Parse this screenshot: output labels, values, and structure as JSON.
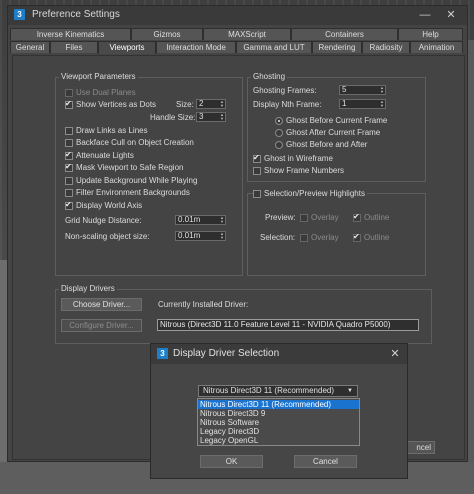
{
  "window": {
    "title": "Preference Settings",
    "minimize": "—",
    "close": "✕"
  },
  "tabs_row1": [
    "Inverse Kinematics",
    "Gizmos",
    "MAXScript",
    "Containers",
    "Help"
  ],
  "tabs_row2": [
    "General",
    "Files",
    "Viewports",
    "Interaction Mode",
    "Gamma and LUT",
    "Rendering",
    "Radiosity",
    "Animation"
  ],
  "active_tab": "Viewports",
  "viewport_params": {
    "label": "Viewport Parameters",
    "use_dual_planes": "Use Dual Planes",
    "show_vertices": "Show Vertices as Dots",
    "size_label": "Size:",
    "size_value": "2",
    "handle_size_label": "Handle Size:",
    "handle_size_value": "3",
    "draw_links": "Draw Links as Lines",
    "backface_cull": "Backface Cull on Object Creation",
    "attenuate_lights": "Attenuate Lights",
    "mask_viewport": "Mask Viewport to Safe Region",
    "update_background": "Update Background While Playing",
    "filter_env": "Filter Environment Backgrounds",
    "display_world_axis": "Display World Axis",
    "grid_nudge_label": "Grid Nudge Distance:",
    "grid_nudge_value": "0.01m",
    "non_scaling_label": "Non-scaling object size:",
    "non_scaling_value": "0.01m"
  },
  "ghosting": {
    "label": "Ghosting",
    "frames_label": "Ghosting Frames:",
    "frames_value": "5",
    "nth_label": "Display Nth Frame:",
    "nth_value": "1",
    "before": "Ghost Before Current Frame",
    "after": "Ghost After Current Frame",
    "before_after": "Ghost Before and After",
    "wireframe": "Ghost in Wireframe",
    "show_numbers": "Show Frame Numbers"
  },
  "selection": {
    "label": "Selection/Preview Highlights",
    "preview_label": "Preview:",
    "selection_label": "Selection:",
    "overlay": "Overlay",
    "outline": "Outline"
  },
  "drivers": {
    "label": "Display Drivers",
    "choose": "Choose Driver...",
    "configure": "Configure Driver...",
    "installed_label": "Currently Installed Driver:",
    "installed_value": "Nitrous (Direct3D 11.0 Feature Level 11 - NVIDIA Quadro P5000)"
  },
  "dialog": {
    "title": "Display Driver Selection",
    "close": "✕",
    "selected": "Nitrous Direct3D 11 (Recommended)",
    "options": [
      "Nitrous Direct3D 11 (Recommended)",
      "Nitrous Direct3D 9",
      "Nitrous Software",
      "Legacy Direct3D",
      "Legacy OpenGL"
    ],
    "ok": "OK",
    "cancel": "Cancel",
    "behind_cancel_fragment": "ncel"
  },
  "colors": {
    "selection_blue": "#1b73d0",
    "app_icon": "#1e7fc8"
  }
}
